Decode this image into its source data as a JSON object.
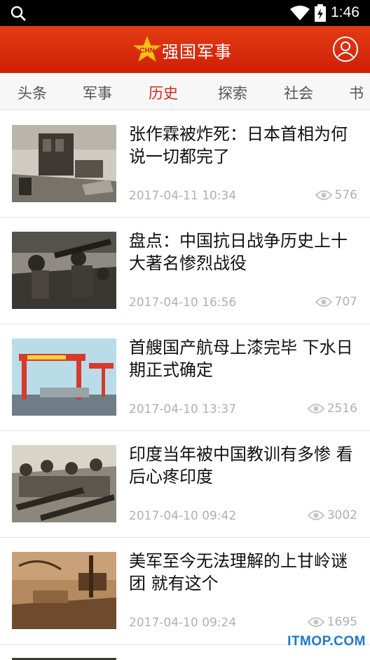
{
  "status_bar": {
    "time": "1:46"
  },
  "header": {
    "title": "强国军事",
    "logo_text": "CHN"
  },
  "tabs": [
    {
      "label": "头条"
    },
    {
      "label": "军事"
    },
    {
      "label": "历史"
    },
    {
      "label": "探索"
    },
    {
      "label": "社会"
    },
    {
      "label": "书"
    }
  ],
  "active_tab": "历史",
  "articles": [
    {
      "title": "张作霖被炸死：日本首相为何说一切都完了",
      "date": "2017-04-11 10:34",
      "views": "576"
    },
    {
      "title": "盘点：中国抗日战争历史上十大著名惨烈战役",
      "date": "2017-04-10 16:56",
      "views": "707"
    },
    {
      "title": "首艘国产航母上漆完毕 下水日期正式确定",
      "date": "2017-04-10 13:37",
      "views": "2516"
    },
    {
      "title": "印度当年被中国教训有多惨 看后心疼印度",
      "date": "2017-04-10 09:42",
      "views": "3002"
    },
    {
      "title": "美军至今无法理解的上甘岭谜团 就有这个",
      "date": "2017-04-10 09:24",
      "views": "1695"
    }
  ],
  "watermark": "ITMOP.COM",
  "colors": {
    "brand_red": "#d62a1a",
    "header_red": "#e33b14",
    "watermark_blue": "#1d78c8"
  },
  "icons": [
    "search-icon",
    "wifi-icon",
    "battery-icon",
    "star-logo-icon",
    "user-icon",
    "eye-icon"
  ]
}
